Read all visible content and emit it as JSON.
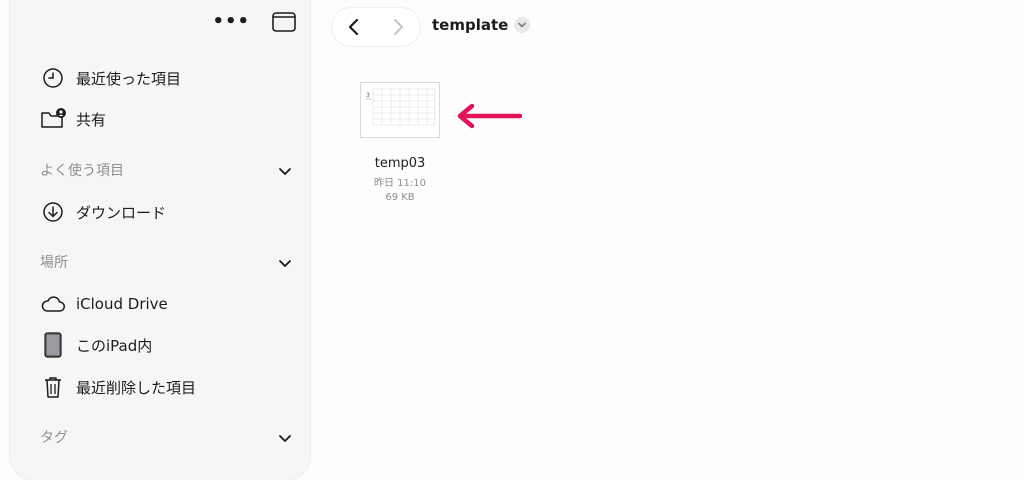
{
  "sidebar": {
    "more_label": "•••",
    "items_top": [
      {
        "label": "最近使った項目",
        "icon": "clock-icon"
      },
      {
        "label": "共有",
        "icon": "shared-folder-icon"
      }
    ],
    "favorites": {
      "header": "よく使う項目",
      "items": [
        {
          "label": "ダウンロード",
          "icon": "download-icon"
        }
      ]
    },
    "locations": {
      "header": "場所",
      "items": [
        {
          "label": "iCloud Drive",
          "icon": "cloud-icon"
        },
        {
          "label": "このiPad内",
          "icon": "ipad-icon"
        },
        {
          "label": "最近削除した項目",
          "icon": "trash-icon"
        }
      ]
    },
    "tags": {
      "header": "タグ"
    }
  },
  "toolbar": {
    "title": "template"
  },
  "files": [
    {
      "name": "temp03",
      "date": "昨日 11:10",
      "size": "69 KB"
    }
  ],
  "colors": {
    "arrow": "#e3135b",
    "sidebar_bg": "#f7f6f4",
    "secondary_text": "#8e8e93"
  }
}
